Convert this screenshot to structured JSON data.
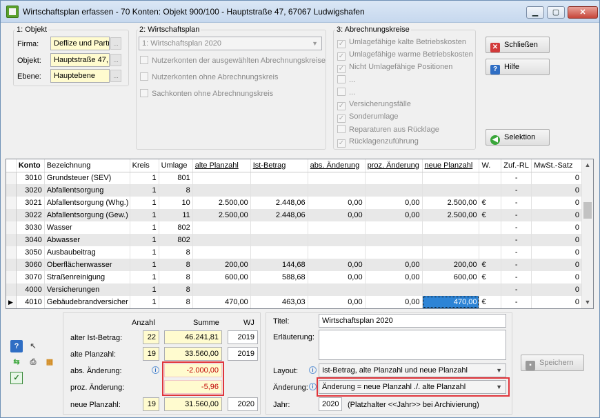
{
  "window": {
    "title": "Wirtschaftsplan erfassen - 70 Konten:  Objekt 900/100 - Hauptstraße 47, 67067 Ludwigshafen",
    "minimize": "▁",
    "maximize": "▢",
    "close": "✕"
  },
  "objekt": {
    "group_title": "1: Objekt",
    "firma_label": "Firma:",
    "firma_value": "Deflize und Partr",
    "objekt_label": "Objekt:",
    "objekt_value": "Hauptstraße 47,",
    "ebene_label": "Ebene:",
    "ebene_value": "Hauptebene",
    "browse": "..."
  },
  "wirtschaftsplan": {
    "group_title": "2: Wirtschaftsplan",
    "select_value": "1: Wirtschaftsplan 2020",
    "options": [
      {
        "label": "Nutzerkonten der ausgewählten Abrechnungskreise",
        "checked": false
      },
      {
        "label": "Nutzerkonten ohne Abrechnungskreis",
        "checked": false
      },
      {
        "label": "Sachkonten ohne Abrechnungskreis",
        "checked": false
      }
    ]
  },
  "abrechnungskreise": {
    "group_title": "3: Abrechnungskreise",
    "items": [
      {
        "label": "Umlagefähige kalte Betriebskosten",
        "checked": true
      },
      {
        "label": "Umlagefähige warme Betriebskosten",
        "checked": true
      },
      {
        "label": "Nicht Umlagefähige Positionen",
        "checked": true
      },
      {
        "label": "...",
        "checked": false
      },
      {
        "label": "...",
        "checked": false
      },
      {
        "label": "Versicherungsfälle",
        "checked": true
      },
      {
        "label": "Sonderumlage",
        "checked": true
      },
      {
        "label": "Reparaturen aus Rücklage",
        "checked": false
      },
      {
        "label": "Rücklagenzuführung",
        "checked": true
      }
    ]
  },
  "buttons": {
    "schliessen": "Schließen",
    "hilfe": "Hilfe",
    "selektion": "Selektion",
    "speichern": "Speichern"
  },
  "table": {
    "headers": [
      "Konto",
      "Bezeichnung",
      "Kreis",
      "Umlage",
      "alte Planzahl",
      "Ist-Betrag",
      "abs. Änderung",
      "proz. Änderung",
      "neue Planzahl",
      "W.",
      "Zuf.-RL",
      "MwSt.-Satz"
    ],
    "rows": [
      [
        "3010",
        "Grundsteuer (SEV)",
        "1",
        "801",
        "",
        "",
        "",
        "",
        "",
        "",
        "-",
        "0"
      ],
      [
        "3020",
        "Abfallentsorgung",
        "1",
        "8",
        "",
        "",
        "",
        "",
        "",
        "",
        "-",
        "0"
      ],
      [
        "3021",
        "Abfallentsorgung (Whg.)",
        "1",
        "10",
        "2.500,00",
        "2.448,06",
        "0,00",
        "0,00",
        "2.500,00",
        "€",
        "-",
        "0"
      ],
      [
        "3022",
        "Abfallentsorgung (Gew.)",
        "1",
        "11",
        "2.500,00",
        "2.448,06",
        "0,00",
        "0,00",
        "2.500,00",
        "€",
        "-",
        "0"
      ],
      [
        "3030",
        "Wasser",
        "1",
        "802",
        "",
        "",
        "",
        "",
        "",
        "",
        "-",
        "0"
      ],
      [
        "3040",
        "Abwasser",
        "1",
        "802",
        "",
        "",
        "",
        "",
        "",
        "",
        "-",
        "0"
      ],
      [
        "3050",
        "Ausbaubeitrag",
        "1",
        "8",
        "",
        "",
        "",
        "",
        "",
        "",
        "-",
        "0"
      ],
      [
        "3060",
        "Oberflächenwasser",
        "1",
        "8",
        "200,00",
        "144,68",
        "0,00",
        "0,00",
        "200,00",
        "€",
        "-",
        "0"
      ],
      [
        "3070",
        "Straßenreinigung",
        "1",
        "8",
        "600,00",
        "588,68",
        "0,00",
        "0,00",
        "600,00",
        "€",
        "-",
        "0"
      ],
      [
        "4000",
        "Versicherungen",
        "1",
        "8",
        "",
        "",
        "",
        "",
        "",
        "",
        "-",
        "0"
      ],
      [
        "4010",
        "Gebäudebrandversicher",
        "1",
        "8",
        "470,00",
        "463,03",
        "0,00",
        "0,00",
        "470,00",
        "€",
        "-",
        "0"
      ]
    ],
    "current_row_marker": "▶"
  },
  "summary": {
    "col_anzahl": "Anzahl",
    "col_summe": "Summe",
    "col_wj": "WJ",
    "alter_ist_label": "alter Ist-Betrag:",
    "alter_ist_anzahl": "22",
    "alter_ist_summe": "46.241,81",
    "alter_ist_wj": "2019",
    "alte_plan_label": "alte Planzahl:",
    "alte_plan_anzahl": "19",
    "alte_plan_summe": "33.560,00",
    "alte_plan_wj": "2019",
    "abs_label": "abs. Änderung:",
    "abs_value": "-2.000,00",
    "proz_label": "proz. Änderung:",
    "proz_value": "-5,96",
    "neue_plan_label": "neue Planzahl:",
    "neue_plan_anzahl": "19",
    "neue_plan_summe": "31.560,00",
    "neue_plan_wj": "2020"
  },
  "details": {
    "titel_label": "Titel:",
    "titel_value": "Wirtschaftsplan 2020",
    "erlaeuterung_label": "Erläuterung:",
    "erlaeuterung_value": "",
    "layout_label": "Layout:",
    "layout_value": "Ist-Betrag, alte Planzahl und neue Planzahl",
    "aenderung_label": "Änderung:",
    "aenderung_value": "Änderung = neue Planzahl ./. alte Planzahl",
    "jahr_label": "Jahr:",
    "jahr_value": "2020",
    "jahr_hint": "(Platzhalter <<Jahr>> bei Archivierung)"
  }
}
